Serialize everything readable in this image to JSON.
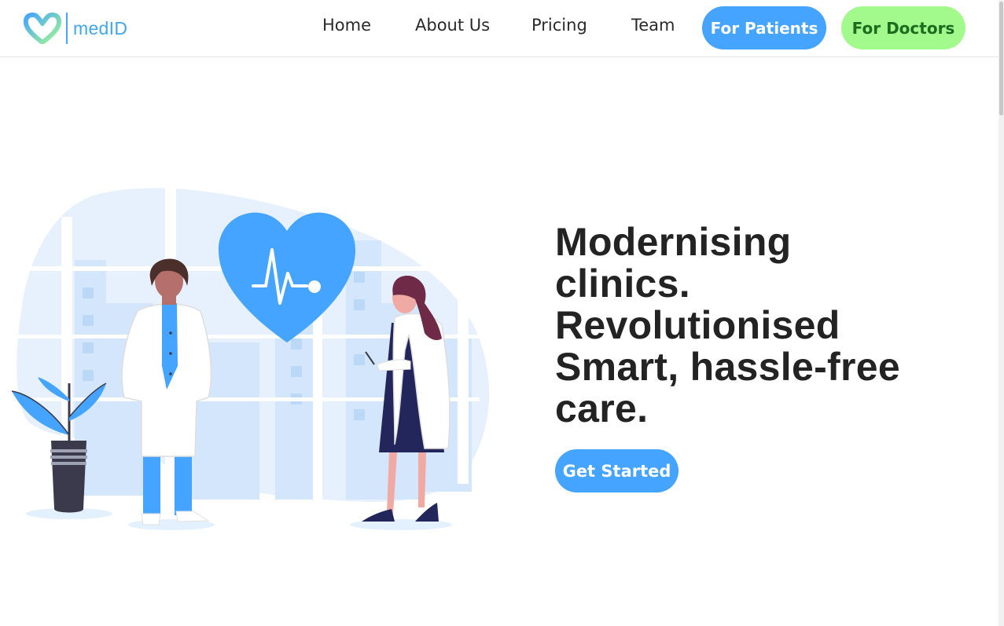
{
  "brand": {
    "name": "medID",
    "accent": "#45a4ff",
    "secondary_accent": "#a2f98c"
  },
  "nav": {
    "links": [
      {
        "label": "Home"
      },
      {
        "label": "About Us"
      },
      {
        "label": "Pricing"
      },
      {
        "label": "Team"
      }
    ],
    "patients_label": "For Patients",
    "doctors_label": "For Doctors"
  },
  "hero": {
    "title_lines": [
      "Modernising",
      "clinics.",
      "Revolutionised",
      "Smart, hassle-free",
      "care."
    ],
    "cta_label": "Get Started",
    "illustration_icons": [
      "heart-pulse-icon",
      "plant-icon",
      "male-doctor",
      "female-doctor"
    ]
  }
}
